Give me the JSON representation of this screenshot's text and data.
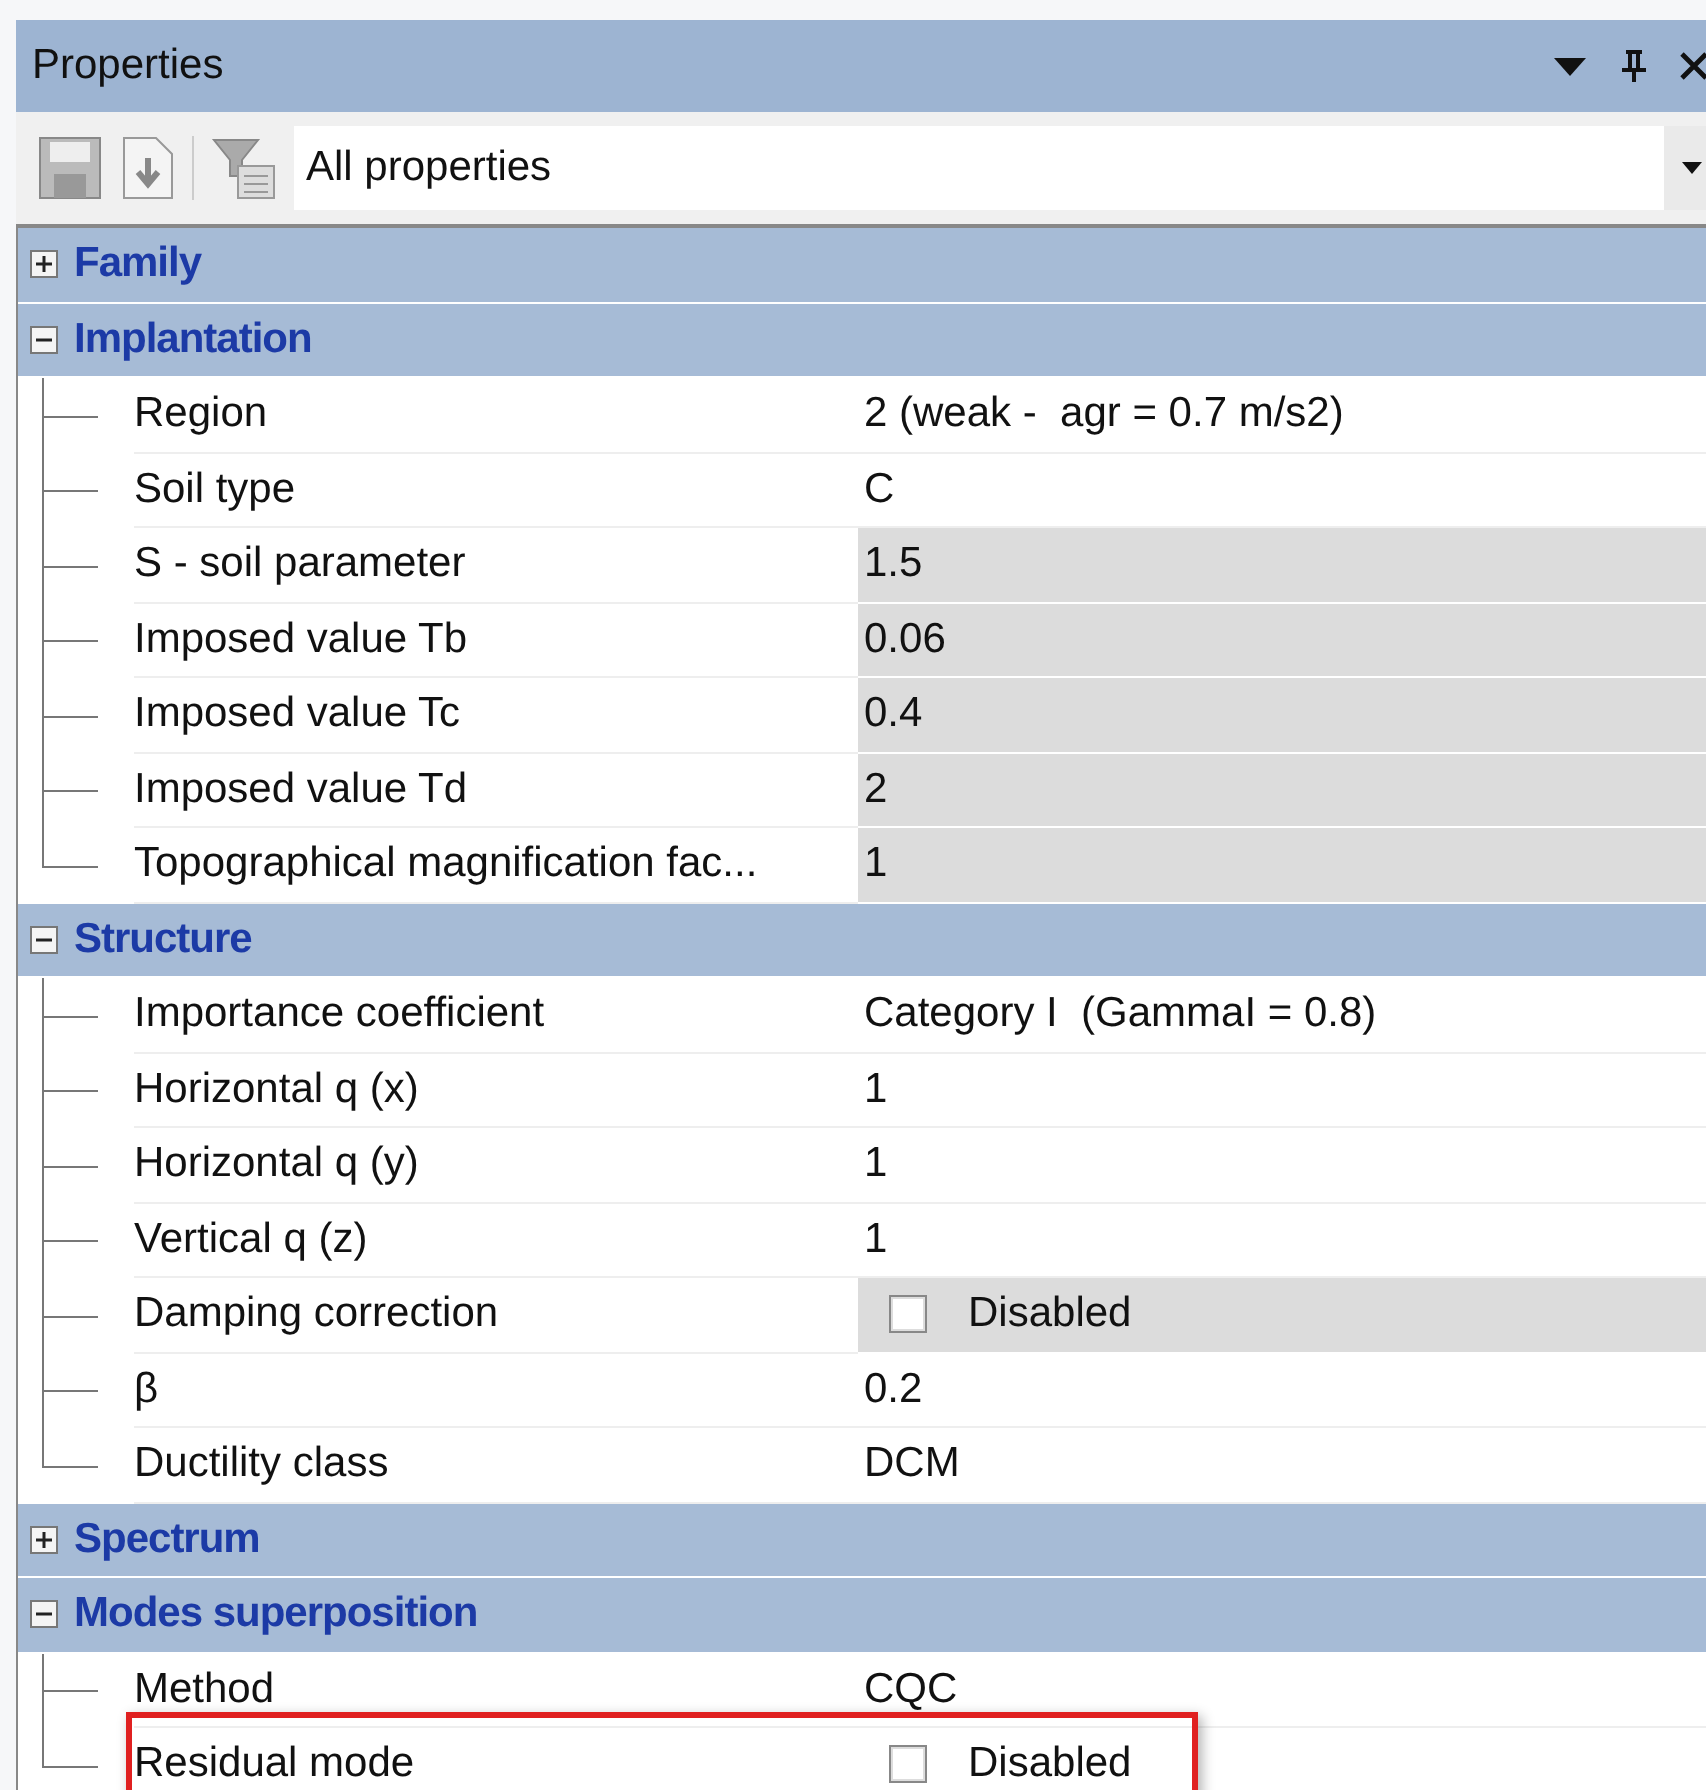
{
  "window": {
    "title": "Properties"
  },
  "toolbar": {
    "filter": "All properties"
  },
  "categories": [
    {
      "name": "Family",
      "expanded": false
    },
    {
      "name": "Implantation",
      "expanded": true,
      "rows": [
        {
          "label": "Region",
          "value": "2 (weak -  agr = 0.7 m/s2)",
          "readonly": false,
          "kind": "text"
        },
        {
          "label": "Soil type",
          "value": "C",
          "readonly": false,
          "kind": "text"
        },
        {
          "label": "S - soil parameter",
          "value": "1.5",
          "readonly": true,
          "kind": "text"
        },
        {
          "label": "Imposed value Tb",
          "value": "0.06",
          "readonly": true,
          "kind": "text"
        },
        {
          "label": "Imposed value Tc",
          "value": "0.4",
          "readonly": true,
          "kind": "text"
        },
        {
          "label": "Imposed value Td",
          "value": "2",
          "readonly": true,
          "kind": "text"
        },
        {
          "label": "Topographical magnification fac...",
          "value": "1",
          "readonly": true,
          "kind": "text"
        }
      ]
    },
    {
      "name": "Structure",
      "expanded": true,
      "rows": [
        {
          "label": "Importance coefficient",
          "value": "Category I  (GammaI = 0.8)",
          "readonly": false,
          "kind": "text"
        },
        {
          "label": "Horizontal q (x)",
          "value": "1",
          "readonly": false,
          "kind": "text"
        },
        {
          "label": "Horizontal q (y)",
          "value": "1",
          "readonly": false,
          "kind": "text"
        },
        {
          "label": "Vertical q (z)",
          "value": "1",
          "readonly": false,
          "kind": "text"
        },
        {
          "label": "Damping correction",
          "value": "Disabled",
          "readonly": true,
          "kind": "checkbox",
          "checked": false
        },
        {
          "label": "β",
          "value": "0.2",
          "readonly": false,
          "kind": "text"
        },
        {
          "label": "Ductility class",
          "value": "DCM",
          "readonly": false,
          "kind": "text"
        }
      ]
    },
    {
      "name": "Spectrum",
      "expanded": false
    },
    {
      "name": "Modes superposition",
      "expanded": true,
      "rows": [
        {
          "label": "Method",
          "value": "CQC",
          "readonly": false,
          "kind": "text"
        },
        {
          "label": "Residual mode",
          "value": "Disabled",
          "readonly": false,
          "kind": "checkbox",
          "checked": false,
          "highlighted": true
        }
      ]
    }
  ]
}
